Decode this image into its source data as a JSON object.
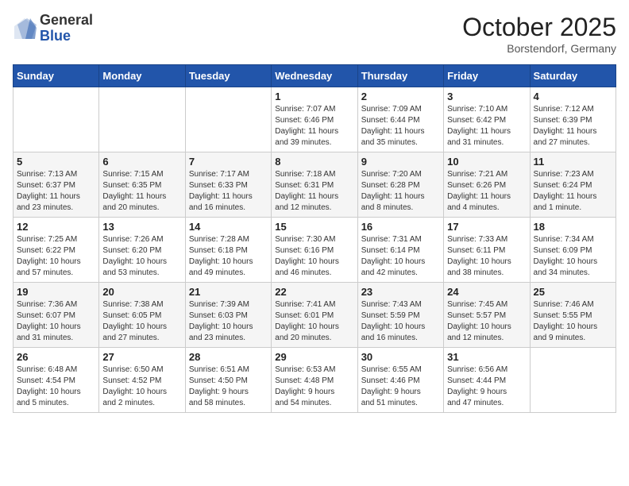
{
  "header": {
    "logo_general": "General",
    "logo_blue": "Blue",
    "month_title": "October 2025",
    "location": "Borstendorf, Germany"
  },
  "weekdays": [
    "Sunday",
    "Monday",
    "Tuesday",
    "Wednesday",
    "Thursday",
    "Friday",
    "Saturday"
  ],
  "weeks": [
    [
      {
        "day": "",
        "info": ""
      },
      {
        "day": "",
        "info": ""
      },
      {
        "day": "",
        "info": ""
      },
      {
        "day": "1",
        "info": "Sunrise: 7:07 AM\nSunset: 6:46 PM\nDaylight: 11 hours\nand 39 minutes."
      },
      {
        "day": "2",
        "info": "Sunrise: 7:09 AM\nSunset: 6:44 PM\nDaylight: 11 hours\nand 35 minutes."
      },
      {
        "day": "3",
        "info": "Sunrise: 7:10 AM\nSunset: 6:42 PM\nDaylight: 11 hours\nand 31 minutes."
      },
      {
        "day": "4",
        "info": "Sunrise: 7:12 AM\nSunset: 6:39 PM\nDaylight: 11 hours\nand 27 minutes."
      }
    ],
    [
      {
        "day": "5",
        "info": "Sunrise: 7:13 AM\nSunset: 6:37 PM\nDaylight: 11 hours\nand 23 minutes."
      },
      {
        "day": "6",
        "info": "Sunrise: 7:15 AM\nSunset: 6:35 PM\nDaylight: 11 hours\nand 20 minutes."
      },
      {
        "day": "7",
        "info": "Sunrise: 7:17 AM\nSunset: 6:33 PM\nDaylight: 11 hours\nand 16 minutes."
      },
      {
        "day": "8",
        "info": "Sunrise: 7:18 AM\nSunset: 6:31 PM\nDaylight: 11 hours\nand 12 minutes."
      },
      {
        "day": "9",
        "info": "Sunrise: 7:20 AM\nSunset: 6:28 PM\nDaylight: 11 hours\nand 8 minutes."
      },
      {
        "day": "10",
        "info": "Sunrise: 7:21 AM\nSunset: 6:26 PM\nDaylight: 11 hours\nand 4 minutes."
      },
      {
        "day": "11",
        "info": "Sunrise: 7:23 AM\nSunset: 6:24 PM\nDaylight: 11 hours\nand 1 minute."
      }
    ],
    [
      {
        "day": "12",
        "info": "Sunrise: 7:25 AM\nSunset: 6:22 PM\nDaylight: 10 hours\nand 57 minutes."
      },
      {
        "day": "13",
        "info": "Sunrise: 7:26 AM\nSunset: 6:20 PM\nDaylight: 10 hours\nand 53 minutes."
      },
      {
        "day": "14",
        "info": "Sunrise: 7:28 AM\nSunset: 6:18 PM\nDaylight: 10 hours\nand 49 minutes."
      },
      {
        "day": "15",
        "info": "Sunrise: 7:30 AM\nSunset: 6:16 PM\nDaylight: 10 hours\nand 46 minutes."
      },
      {
        "day": "16",
        "info": "Sunrise: 7:31 AM\nSunset: 6:14 PM\nDaylight: 10 hours\nand 42 minutes."
      },
      {
        "day": "17",
        "info": "Sunrise: 7:33 AM\nSunset: 6:11 PM\nDaylight: 10 hours\nand 38 minutes."
      },
      {
        "day": "18",
        "info": "Sunrise: 7:34 AM\nSunset: 6:09 PM\nDaylight: 10 hours\nand 34 minutes."
      }
    ],
    [
      {
        "day": "19",
        "info": "Sunrise: 7:36 AM\nSunset: 6:07 PM\nDaylight: 10 hours\nand 31 minutes."
      },
      {
        "day": "20",
        "info": "Sunrise: 7:38 AM\nSunset: 6:05 PM\nDaylight: 10 hours\nand 27 minutes."
      },
      {
        "day": "21",
        "info": "Sunrise: 7:39 AM\nSunset: 6:03 PM\nDaylight: 10 hours\nand 23 minutes."
      },
      {
        "day": "22",
        "info": "Sunrise: 7:41 AM\nSunset: 6:01 PM\nDaylight: 10 hours\nand 20 minutes."
      },
      {
        "day": "23",
        "info": "Sunrise: 7:43 AM\nSunset: 5:59 PM\nDaylight: 10 hours\nand 16 minutes."
      },
      {
        "day": "24",
        "info": "Sunrise: 7:45 AM\nSunset: 5:57 PM\nDaylight: 10 hours\nand 12 minutes."
      },
      {
        "day": "25",
        "info": "Sunrise: 7:46 AM\nSunset: 5:55 PM\nDaylight: 10 hours\nand 9 minutes."
      }
    ],
    [
      {
        "day": "26",
        "info": "Sunrise: 6:48 AM\nSunset: 4:54 PM\nDaylight: 10 hours\nand 5 minutes."
      },
      {
        "day": "27",
        "info": "Sunrise: 6:50 AM\nSunset: 4:52 PM\nDaylight: 10 hours\nand 2 minutes."
      },
      {
        "day": "28",
        "info": "Sunrise: 6:51 AM\nSunset: 4:50 PM\nDaylight: 9 hours\nand 58 minutes."
      },
      {
        "day": "29",
        "info": "Sunrise: 6:53 AM\nSunset: 4:48 PM\nDaylight: 9 hours\nand 54 minutes."
      },
      {
        "day": "30",
        "info": "Sunrise: 6:55 AM\nSunset: 4:46 PM\nDaylight: 9 hours\nand 51 minutes."
      },
      {
        "day": "31",
        "info": "Sunrise: 6:56 AM\nSunset: 4:44 PM\nDaylight: 9 hours\nand 47 minutes."
      },
      {
        "day": "",
        "info": ""
      }
    ]
  ]
}
